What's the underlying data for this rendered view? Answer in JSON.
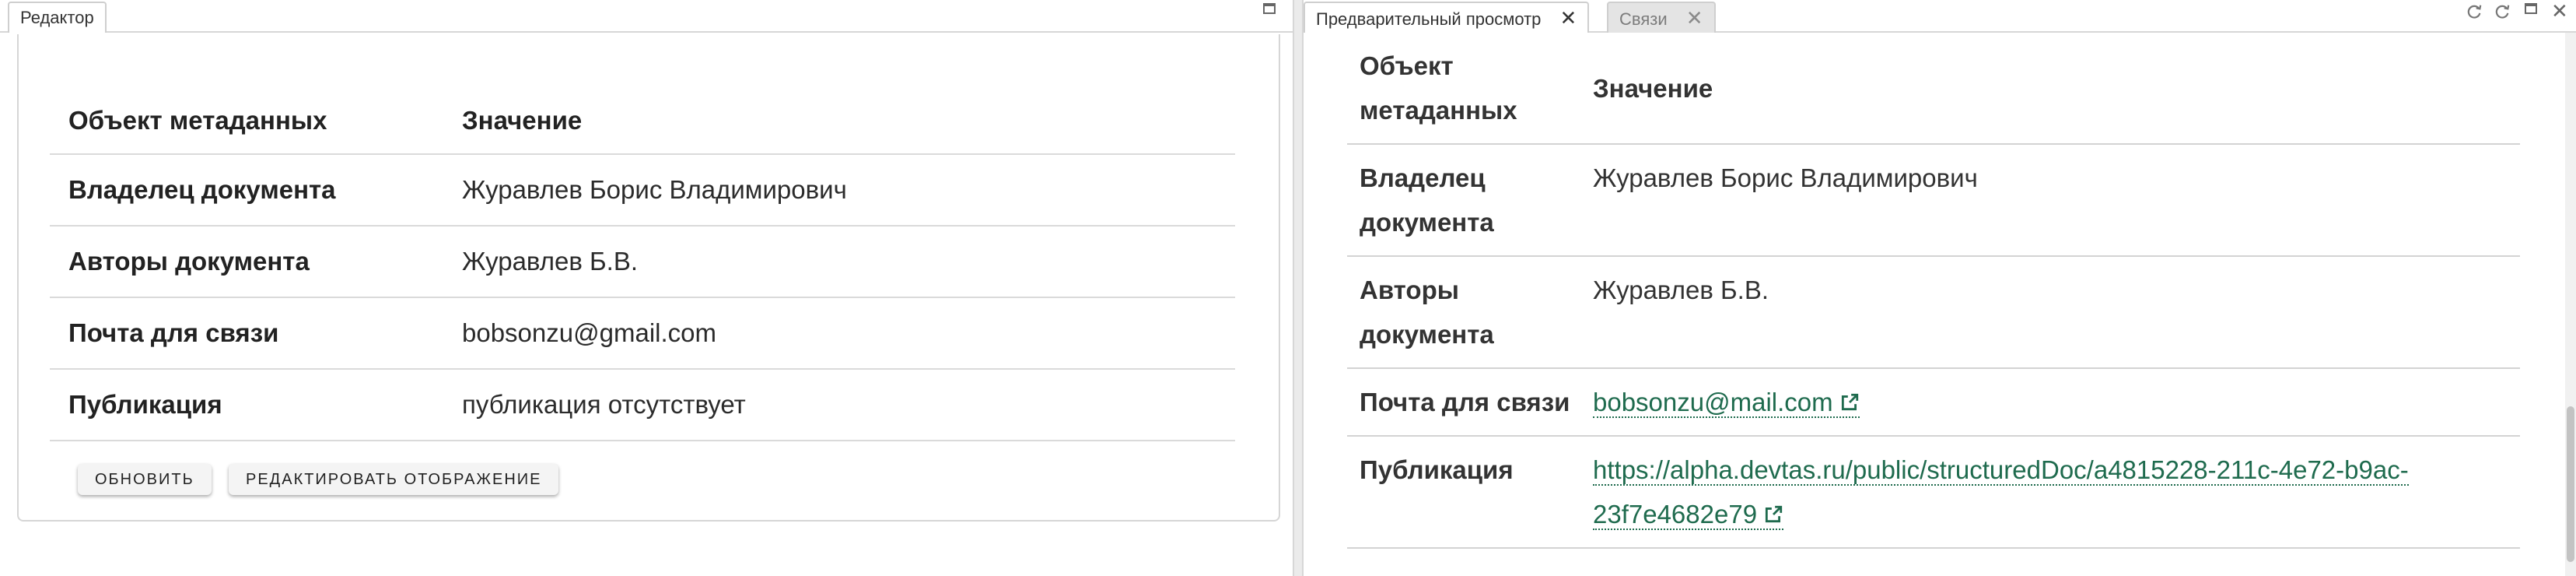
{
  "editor": {
    "tab_label": "Редактор",
    "table": {
      "header_key": "Объект метаданных",
      "header_value": "Значение",
      "rows": [
        {
          "key": "Владелец документа",
          "value": "Журавлев Борис Владимирович"
        },
        {
          "key": "Авторы документа",
          "value": "Журавлев Б.В."
        },
        {
          "key": "Почта для связи",
          "value": "bobsonzu@gmail.com"
        },
        {
          "key": "Публикация",
          "value": "публикация отсутствует"
        }
      ]
    },
    "buttons": {
      "refresh_label": "ОБНОВИТЬ",
      "edit_display_label": "РЕДАКТИРОВАТЬ ОТОБРАЖЕНИЕ"
    }
  },
  "preview": {
    "tabs": [
      {
        "label": "Предварительный просмотр",
        "active": true
      },
      {
        "label": "Связи",
        "active": false
      }
    ],
    "table": {
      "header_key_line1": "Объект",
      "header_key_line2": "метаданных",
      "header_value": "Значение",
      "rows": [
        {
          "key_line1": "Владелец",
          "key_line2": "документа",
          "value": "Журавлев Борис Владимирович"
        },
        {
          "key_line1": "Авторы",
          "key_line2": "документа",
          "value": "Журавлев Б.В."
        },
        {
          "key_line1": "Почта для связи",
          "key_line2": "",
          "value": "bobsonzu@mail.com",
          "is_link": true
        },
        {
          "key_line1": "Публикация",
          "key_line2": "",
          "value_line1": "https://alpha.devtas.ru/public/structuredDoc/a4815228-211c-4e72-b9ac-",
          "value_line2": "23f7e4682e79",
          "is_link": true
        }
      ]
    }
  },
  "colors": {
    "link": "#1f6b4e",
    "border": "#d7d7d7",
    "inactive_tab_bg": "#e4e4e4"
  },
  "icons": [
    "maximize-icon",
    "close-icon",
    "refresh-icon",
    "external-link-icon"
  ]
}
